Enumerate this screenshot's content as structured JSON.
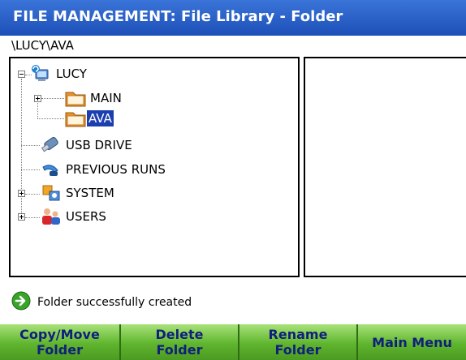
{
  "window": {
    "title": "FILE MANAGEMENT: File Library - Folder"
  },
  "current_path": "\\LUCY\\AVA",
  "tree": {
    "root": {
      "label": "LUCY",
      "icon": "computer-icon"
    },
    "items": [
      {
        "label": "MAIN",
        "icon": "folder-icon"
      },
      {
        "label": "AVA",
        "icon": "open-folder-icon",
        "selected": true
      },
      {
        "label": "USB DRIVE",
        "icon": "usb-drive-icon"
      },
      {
        "label": "PREVIOUS RUNS",
        "icon": "previous-runs-icon"
      },
      {
        "label": "SYSTEM",
        "icon": "system-icon"
      },
      {
        "label": "USERS",
        "icon": "users-icon"
      }
    ]
  },
  "status": {
    "message": "Folder successfully created",
    "icon": "arrow-right-circle-icon"
  },
  "buttons": {
    "copy_move": "Copy/Move\nFolder",
    "delete": "Delete\nFolder",
    "rename": "Rename\nFolder",
    "main_menu": "Main Menu"
  },
  "colors": {
    "title_bar": "#1d50b8",
    "selection": "#1c3fb0",
    "button_green": "#5fb52e",
    "button_text": "#10207a"
  }
}
